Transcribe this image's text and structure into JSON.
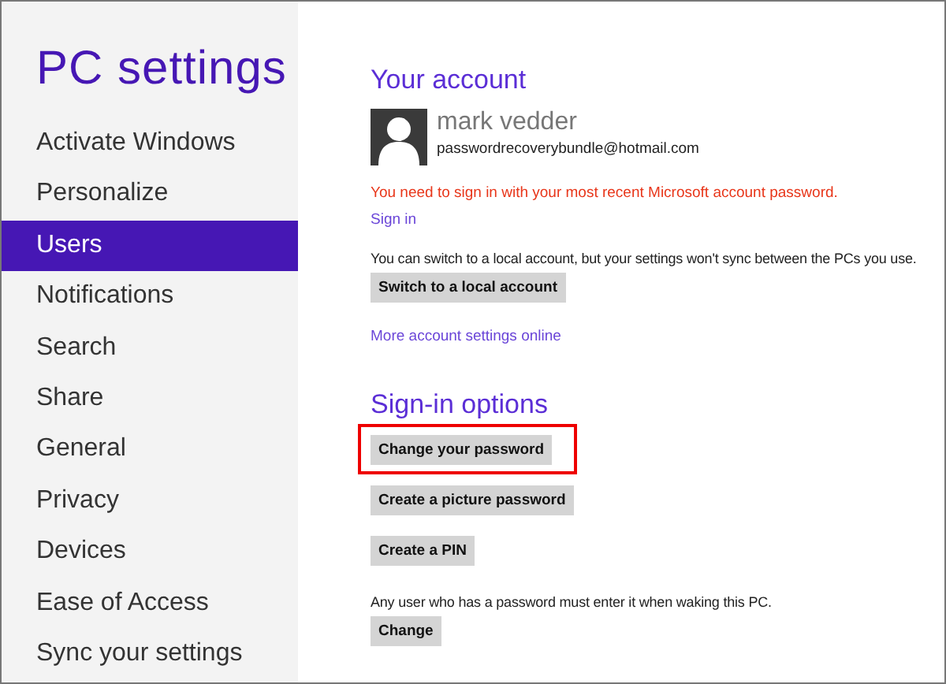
{
  "sidebar": {
    "title": "PC settings",
    "items": [
      {
        "label": "Activate Windows",
        "selected": false
      },
      {
        "label": "Personalize",
        "selected": false
      },
      {
        "label": "Users",
        "selected": true
      },
      {
        "label": "Notifications",
        "selected": false
      },
      {
        "label": "Search",
        "selected": false
      },
      {
        "label": "Share",
        "selected": false
      },
      {
        "label": "General",
        "selected": false
      },
      {
        "label": "Privacy",
        "selected": false
      },
      {
        "label": "Devices",
        "selected": false
      },
      {
        "label": "Ease of Access",
        "selected": false
      },
      {
        "label": "Sync your settings",
        "selected": false
      }
    ]
  },
  "account": {
    "heading": "Your account",
    "name": "mark vedder",
    "email": "passwordrecoverybundle@hotmail.com",
    "warning": "You need to sign in with your most recent Microsoft account password.",
    "sign_in_link": "Sign in",
    "switch_note": "You can switch to a local account, but your settings won't sync between the PCs you use.",
    "switch_button": "Switch to a local account",
    "more_link": "More account settings online"
  },
  "sign_in_options": {
    "heading": "Sign-in options",
    "buttons": [
      {
        "label": "Change your password",
        "highlighted": true
      },
      {
        "label": "Create a picture password",
        "highlighted": false
      },
      {
        "label": "Create a PIN",
        "highlighted": false
      }
    ],
    "wake_note": "Any user who has a password must enter it when waking this PC.",
    "wake_button": "Change"
  }
}
